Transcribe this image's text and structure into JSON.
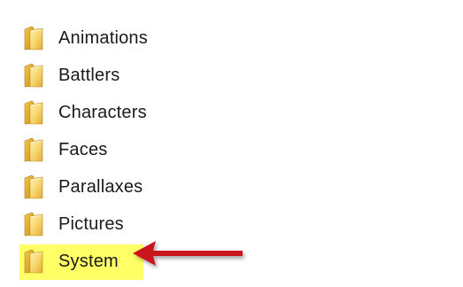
{
  "folders": [
    {
      "label": "Animations",
      "icon": "folder-icon",
      "highlighted": false
    },
    {
      "label": "Battlers",
      "icon": "folder-icon",
      "highlighted": false
    },
    {
      "label": "Characters",
      "icon": "folder-icon",
      "highlighted": false
    },
    {
      "label": "Faces",
      "icon": "folder-icon",
      "highlighted": false
    },
    {
      "label": "Parallaxes",
      "icon": "folder-icon",
      "highlighted": false
    },
    {
      "label": "Pictures",
      "icon": "folder-icon",
      "highlighted": false
    },
    {
      "label": "System",
      "icon": "folder-icon",
      "highlighted": true
    }
  ],
  "colors": {
    "highlight": "#ffff66",
    "arrow": "#c8161d",
    "folder_light": "#f7d978",
    "folder_dark": "#d9a82e"
  },
  "annotation": {
    "icon": "arrow-left-icon",
    "points_to": "System"
  }
}
